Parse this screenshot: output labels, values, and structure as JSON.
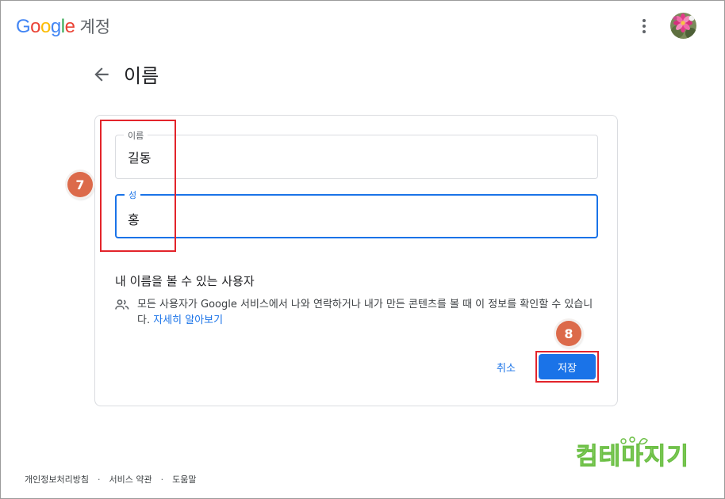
{
  "header": {
    "logo_letters": [
      {
        "ch": "G",
        "color": "#4285F4"
      },
      {
        "ch": "o",
        "color": "#EA4335"
      },
      {
        "ch": "o",
        "color": "#FBBC05"
      },
      {
        "ch": "g",
        "color": "#4285F4"
      },
      {
        "ch": "l",
        "color": "#34A853"
      },
      {
        "ch": "e",
        "color": "#EA4335"
      }
    ],
    "logo_suffix": "계정",
    "menu_icon": "more-vert-icon",
    "avatar_icon": "profile-avatar-icon"
  },
  "page": {
    "title": "이름",
    "back_icon": "arrow-back-icon"
  },
  "form": {
    "first_name": {
      "label": "이름",
      "value": "길동"
    },
    "last_name": {
      "label": "성",
      "value": "홍"
    }
  },
  "visibility": {
    "title": "내 이름을 볼 수 있는 사용자",
    "icon": "people-icon",
    "description": "모든 사용자가 Google 서비스에서 나와 연락하거나 내가 만든 콘텐츠를 볼 때 이 정보를 확인할 수 있습니다.",
    "learn_more": "자세히 알아보기"
  },
  "actions": {
    "cancel": "취소",
    "save": "저장"
  },
  "annotations": {
    "step_fields": "7",
    "step_save": "8",
    "highlight_color": "#E3242B",
    "step_color": "#DC6A4A"
  },
  "watermark": {
    "text": "컴테마지기"
  },
  "footer": {
    "links": [
      "개인정보처리방침",
      "서비스 약관",
      "도움말"
    ]
  },
  "colors": {
    "accent": "#1A73E8",
    "border": "#DADCE0"
  }
}
